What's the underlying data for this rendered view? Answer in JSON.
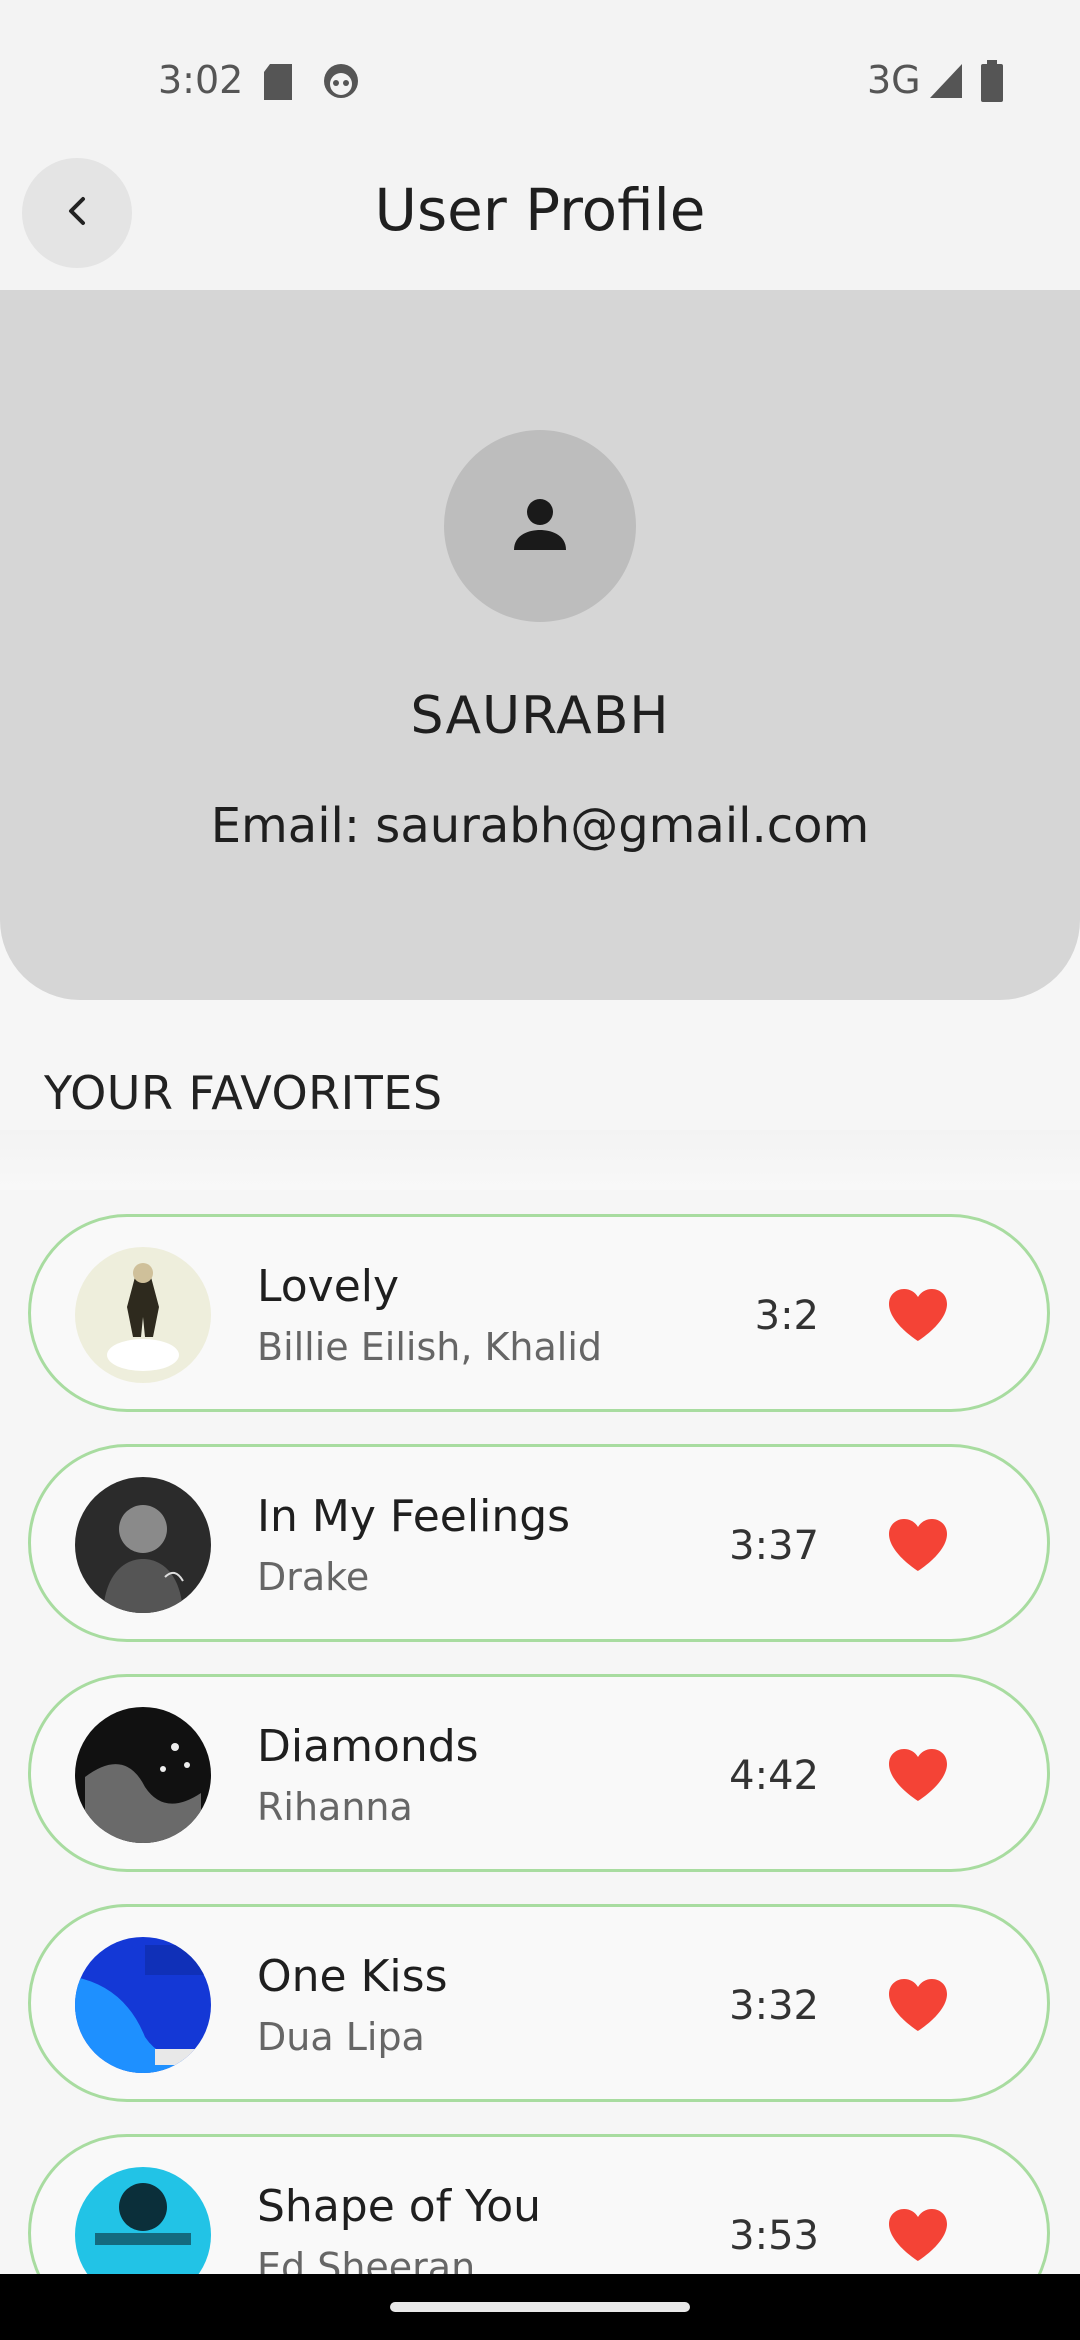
{
  "status_bar": {
    "time": "3:02",
    "network": "3G",
    "icons": [
      "sd-card-icon",
      "face-icon",
      "signal-icon",
      "battery-icon"
    ]
  },
  "app_bar": {
    "title": "User Profile",
    "back_icon": "chevron-left-icon"
  },
  "profile": {
    "avatar_icon": "person-icon",
    "name": "SAURABH",
    "email": "Email: saurabh@gmail.com"
  },
  "favorites": {
    "title": "YOUR FAVORITES",
    "items": [
      {
        "title": "Lovely",
        "artist": "Billie Eilish, Khalid",
        "duration": "3:2"
      },
      {
        "title": "In My Feelings",
        "artist": "Drake",
        "duration": "3:37"
      },
      {
        "title": "Diamonds",
        "artist": "Rihanna",
        "duration": "4:42"
      },
      {
        "title": "One Kiss",
        "artist": "Dua Lipa",
        "duration": "3:32"
      },
      {
        "title": "Shape of You",
        "artist": "Ed Sheeran",
        "duration": "3:53"
      }
    ]
  },
  "colors": {
    "accent_border": "#a8dca0",
    "heart": "#f44336",
    "profile_card": "#d6d6d6"
  }
}
